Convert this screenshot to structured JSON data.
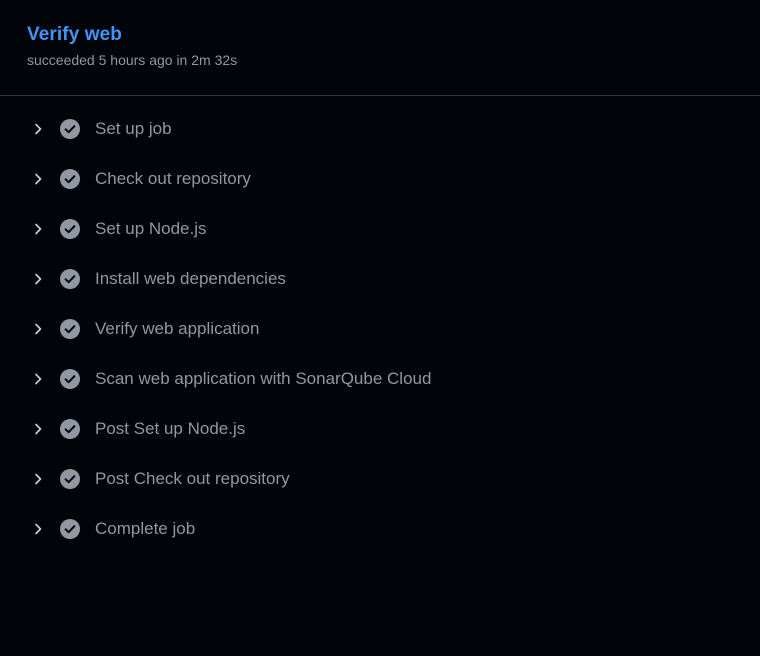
{
  "job": {
    "title": "Verify web",
    "status": "succeeded 5 hours ago in 2m 32s"
  },
  "colors": {
    "background": "#010409",
    "title": "#4493f8",
    "muted_text": "#9198a1",
    "border": "#30363d",
    "check_circle": "#9198a1"
  },
  "steps": [
    {
      "label": "Set up job",
      "status": "success",
      "icon": "check-circle-icon"
    },
    {
      "label": "Check out repository",
      "status": "success",
      "icon": "check-circle-icon"
    },
    {
      "label": "Set up Node.js",
      "status": "success",
      "icon": "check-circle-icon"
    },
    {
      "label": "Install web dependencies",
      "status": "success",
      "icon": "check-circle-icon"
    },
    {
      "label": "Verify web application",
      "status": "success",
      "icon": "check-circle-icon"
    },
    {
      "label": "Scan web application with SonarQube Cloud",
      "status": "success",
      "icon": "check-circle-icon"
    },
    {
      "label": "Post Set up Node.js",
      "status": "success",
      "icon": "check-circle-icon"
    },
    {
      "label": "Post Check out repository",
      "status": "success",
      "icon": "check-circle-icon"
    },
    {
      "label": "Complete job",
      "status": "success",
      "icon": "check-circle-icon"
    }
  ]
}
